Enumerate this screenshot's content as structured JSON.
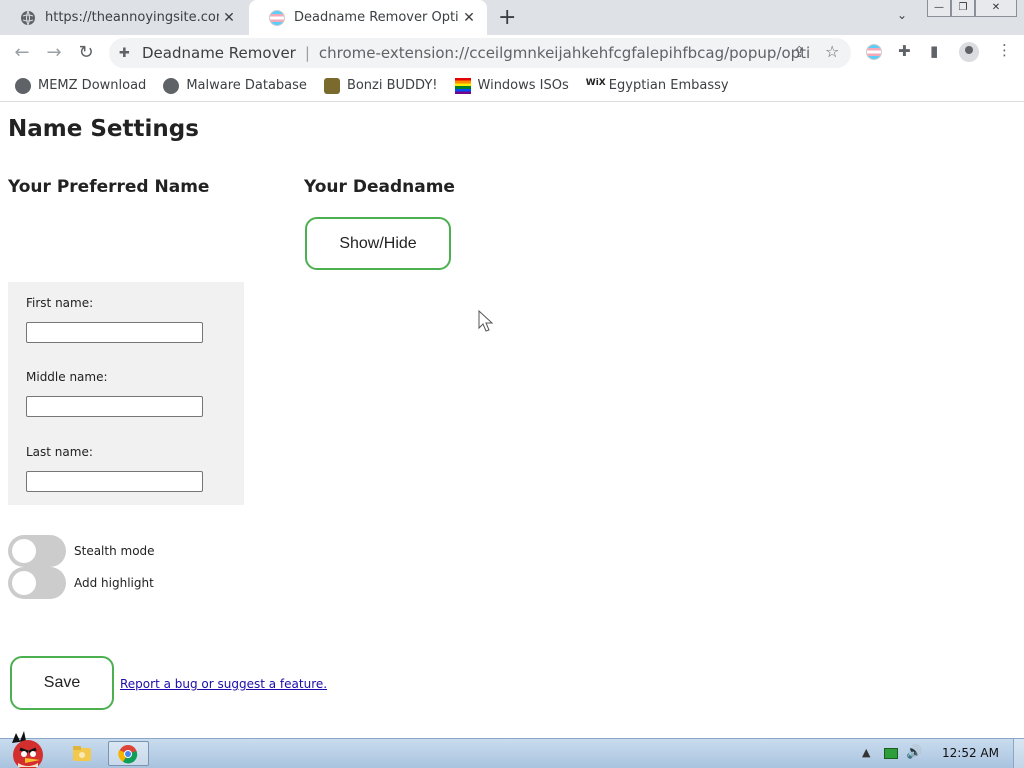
{
  "browser": {
    "tabs": [
      {
        "title": "https://theannoyingsite.com",
        "icon": "globe-icon",
        "active": false
      },
      {
        "title": "Deadname Remover Options",
        "icon": "trans-flag-icon",
        "active": true
      }
    ],
    "new_tab": "+",
    "tab_search": "⌄",
    "window_controls": {
      "minimize": "—",
      "restore": "❐",
      "close": "✕"
    },
    "nav": {
      "back": "←",
      "forward": "→",
      "reload": "↻"
    },
    "omnibox": {
      "site_name": "Deadname Remover",
      "separator": "|",
      "url": "chrome-extension://cceilgmnkeijahkehfcgfalepihfbcag/popup/options...."
    }
  },
  "bookmarks": [
    {
      "label": "MEMZ Download",
      "icon": "globe-icon"
    },
    {
      "label": "Malware Database",
      "icon": "globe-icon"
    },
    {
      "label": "Bonzi BUDDY!",
      "icon": "bonzi-icon"
    },
    {
      "label": "Windows ISOs",
      "icon": "rainbow-flag-icon"
    },
    {
      "label": "Egyptian Embassy",
      "icon": "wix-icon",
      "icon_text": "WiX"
    }
  ],
  "page": {
    "title": "Name Settings",
    "preferred_heading": "Your Preferred Name",
    "deadname_heading": "Your Deadname",
    "show_hide_label": "Show/Hide",
    "form": {
      "first_label": "First name:",
      "first_value": "",
      "middle_label": "Middle name:",
      "middle_value": "",
      "last_label": "Last name:",
      "last_value": ""
    },
    "toggles": [
      {
        "label": "Stealth mode",
        "on": false
      },
      {
        "label": "Add highlight",
        "on": false
      }
    ],
    "save_label": "Save",
    "report_link": "Report a bug or suggest a feature."
  },
  "taskbar": {
    "clock": "12:52 AM",
    "tray_up_arrow": "▲",
    "volume_icon": "🔊"
  },
  "colors": {
    "accent_green": "#4caf50",
    "tab_strip": "#dee1e6",
    "link": "#1a0dab",
    "form_bg": "#f1f1f1",
    "toggle_off": "#cccccc"
  }
}
